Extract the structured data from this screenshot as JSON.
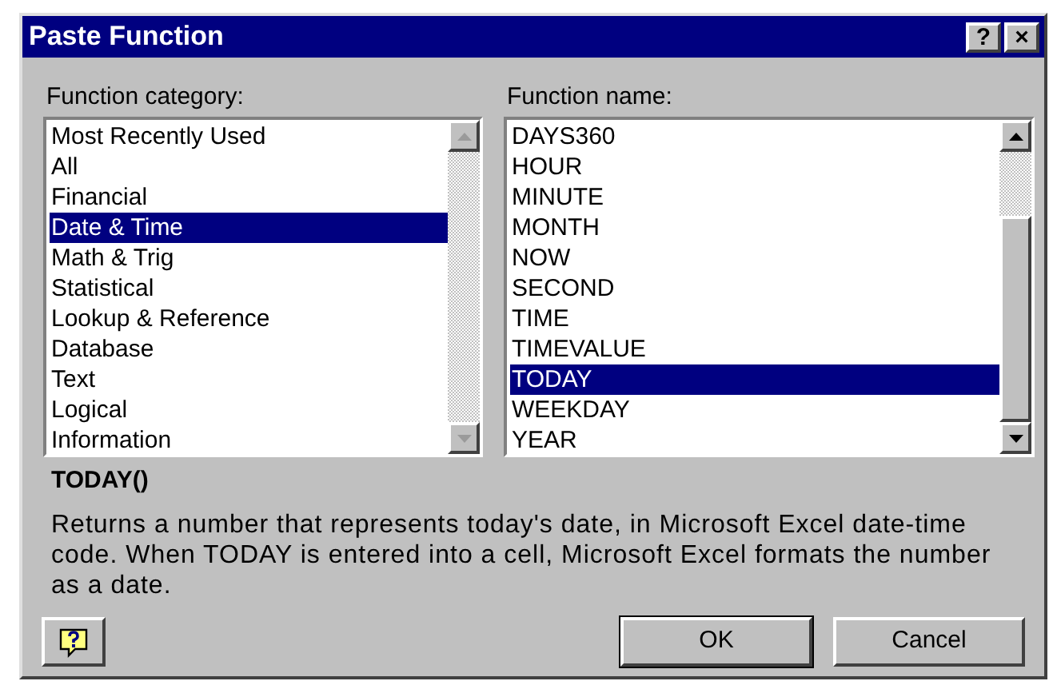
{
  "window": {
    "title": "Paste Function",
    "title_buttons": [
      "?",
      "×"
    ]
  },
  "category": {
    "label": "Function category:",
    "items": [
      {
        "label": "Most Recently Used",
        "selected": false
      },
      {
        "label": "All",
        "selected": false
      },
      {
        "label": "Financial",
        "selected": false
      },
      {
        "label": "Date & Time",
        "selected": true
      },
      {
        "label": "Math & Trig",
        "selected": false
      },
      {
        "label": "Statistical",
        "selected": false
      },
      {
        "label": "Lookup & Reference",
        "selected": false
      },
      {
        "label": "Database",
        "selected": false
      },
      {
        "label": "Text",
        "selected": false
      },
      {
        "label": "Logical",
        "selected": false
      },
      {
        "label": "Information",
        "selected": false
      }
    ],
    "scroll_disabled": true
  },
  "function": {
    "label": "Function name:",
    "items": [
      {
        "label": "DAYS360",
        "selected": false
      },
      {
        "label": "HOUR",
        "selected": false
      },
      {
        "label": "MINUTE",
        "selected": false
      },
      {
        "label": "MONTH",
        "selected": false
      },
      {
        "label": "NOW",
        "selected": false
      },
      {
        "label": "SECOND",
        "selected": false
      },
      {
        "label": "TIME",
        "selected": false
      },
      {
        "label": "TIMEVALUE",
        "selected": false
      },
      {
        "label": "TODAY",
        "selected": true
      },
      {
        "label": "WEEKDAY",
        "selected": false
      },
      {
        "label": "YEAR",
        "selected": false
      }
    ],
    "scroll_disabled": false
  },
  "syntax": "TODAY()",
  "description": "Returns a number that represents today's date, in Microsoft Excel date-time code. When TODAY is entered into a cell, Microsoft Excel formats the number as a date.",
  "buttons": [
    "OK",
    "Cancel"
  ]
}
